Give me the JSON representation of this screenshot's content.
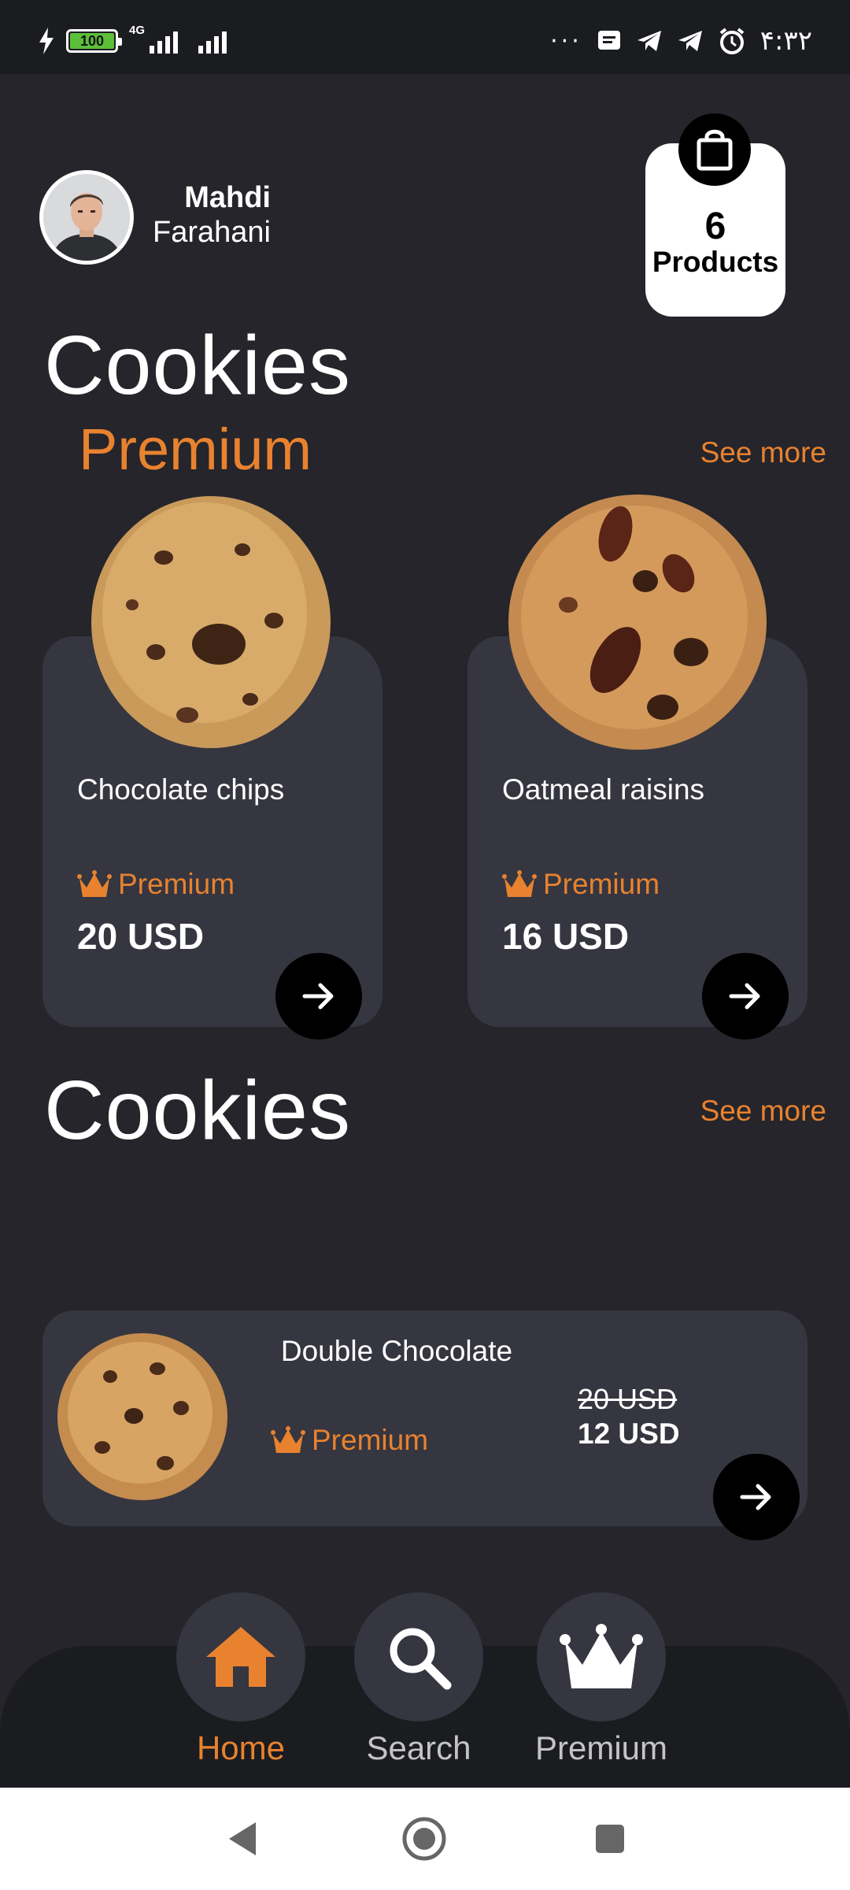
{
  "status_bar": {
    "battery": "100",
    "network": "4G",
    "time": "۴:۳۲"
  },
  "user": {
    "first_name": "Mahdi",
    "last_name": "Farahani"
  },
  "cart": {
    "count": "6",
    "label": "Products"
  },
  "sections": {
    "premium_title": "Cookies",
    "premium_subtitle": "Premium",
    "premium_see_more": "See more",
    "regular_title": "Cookies",
    "regular_see_more": "See more"
  },
  "premium_products": [
    {
      "name": "Chocolate chips",
      "tier": "Premium",
      "price": "20 USD"
    },
    {
      "name": "Oatmeal raisins",
      "tier": "Premium",
      "price": "16 USD"
    }
  ],
  "regular_product": {
    "name": "Double Chocolate",
    "tier": "Premium",
    "old_price": "20 USD",
    "price": "12 USD"
  },
  "bottom_nav": {
    "items": [
      {
        "label": "Home",
        "icon": "home-icon",
        "active": true
      },
      {
        "label": "Search",
        "icon": "search-icon",
        "active": false
      },
      {
        "label": "Premium",
        "icon": "crown-icon",
        "active": false
      }
    ]
  },
  "colors": {
    "background": "#25252b",
    "card": "#353640",
    "accent": "#e8822f",
    "nav_bar": "#1b1c20"
  }
}
